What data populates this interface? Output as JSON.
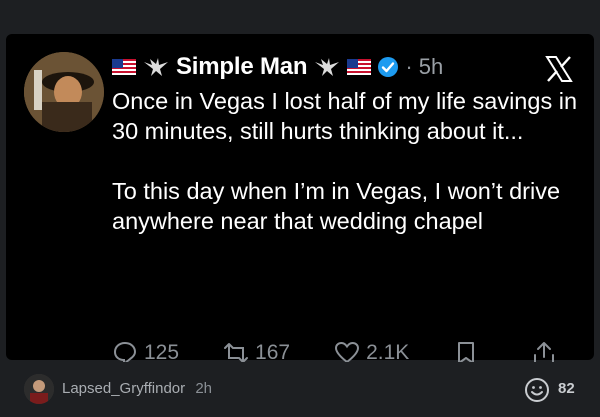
{
  "tweet": {
    "author_name": "Simple Man",
    "time": "5h",
    "dot": "·",
    "paragraphs": [
      "Once in Vegas I lost half of my life savings in 30 minutes, still hurts thinking about it...",
      "To this day when I’m in Vegas, I won’t drive anywhere near that wedding chapel"
    ],
    "actions": {
      "replies": "125",
      "retweets": "167",
      "likes": "2.1K"
    }
  },
  "comment": {
    "username": "Lapsed_Gryffindor",
    "time": "2h",
    "reaction_count": "82"
  },
  "colors": {
    "background": "#1d1f22",
    "card": "#000000",
    "text": "#ffffff",
    "muted": "#8b9096",
    "verified": "#1d9bf0"
  }
}
